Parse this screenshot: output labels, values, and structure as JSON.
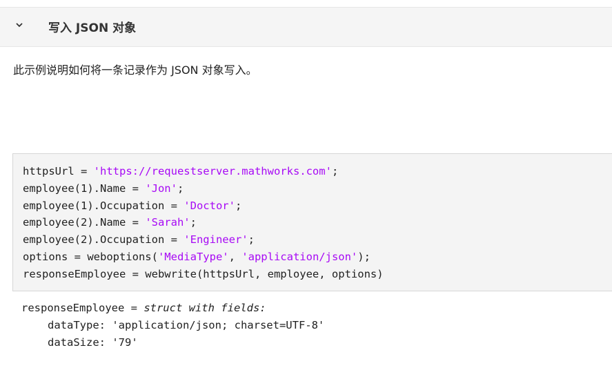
{
  "section": {
    "title": "写入 JSON 对象",
    "toggle_icon": "chevron-down-icon"
  },
  "description": "此示例说明如何将一条记录作为 JSON 对象写入。",
  "code": {
    "lines": [
      {
        "pre": "httpsUrl = ",
        "str": "'https://requestserver.mathworks.com'",
        "post": ";"
      },
      {
        "pre": "employee(1).Name = ",
        "str": "'Jon'",
        "post": ";"
      },
      {
        "pre": "employee(1).Occupation = ",
        "str": "'Doctor'",
        "post": ";"
      },
      {
        "pre": "employee(2).Name = ",
        "str": "'Sarah'",
        "post": ";"
      },
      {
        "pre": "employee(2).Occupation = ",
        "str": "'Engineer'",
        "post": ";"
      },
      {
        "pre": "options = weboptions(",
        "str": "'MediaType'",
        "mid": ", ",
        "str2": "'application/json'",
        "post": ");"
      },
      {
        "pre": "responseEmployee = webwrite(httpsUrl, employee, options)"
      }
    ],
    "string_color": "#a709f5"
  },
  "output": {
    "var": "responseEmployee = ",
    "type_text": "struct with fields:",
    "fields": [
      "dataType: 'application/json; charset=UTF-8'",
      "dataSize: '79'"
    ]
  }
}
